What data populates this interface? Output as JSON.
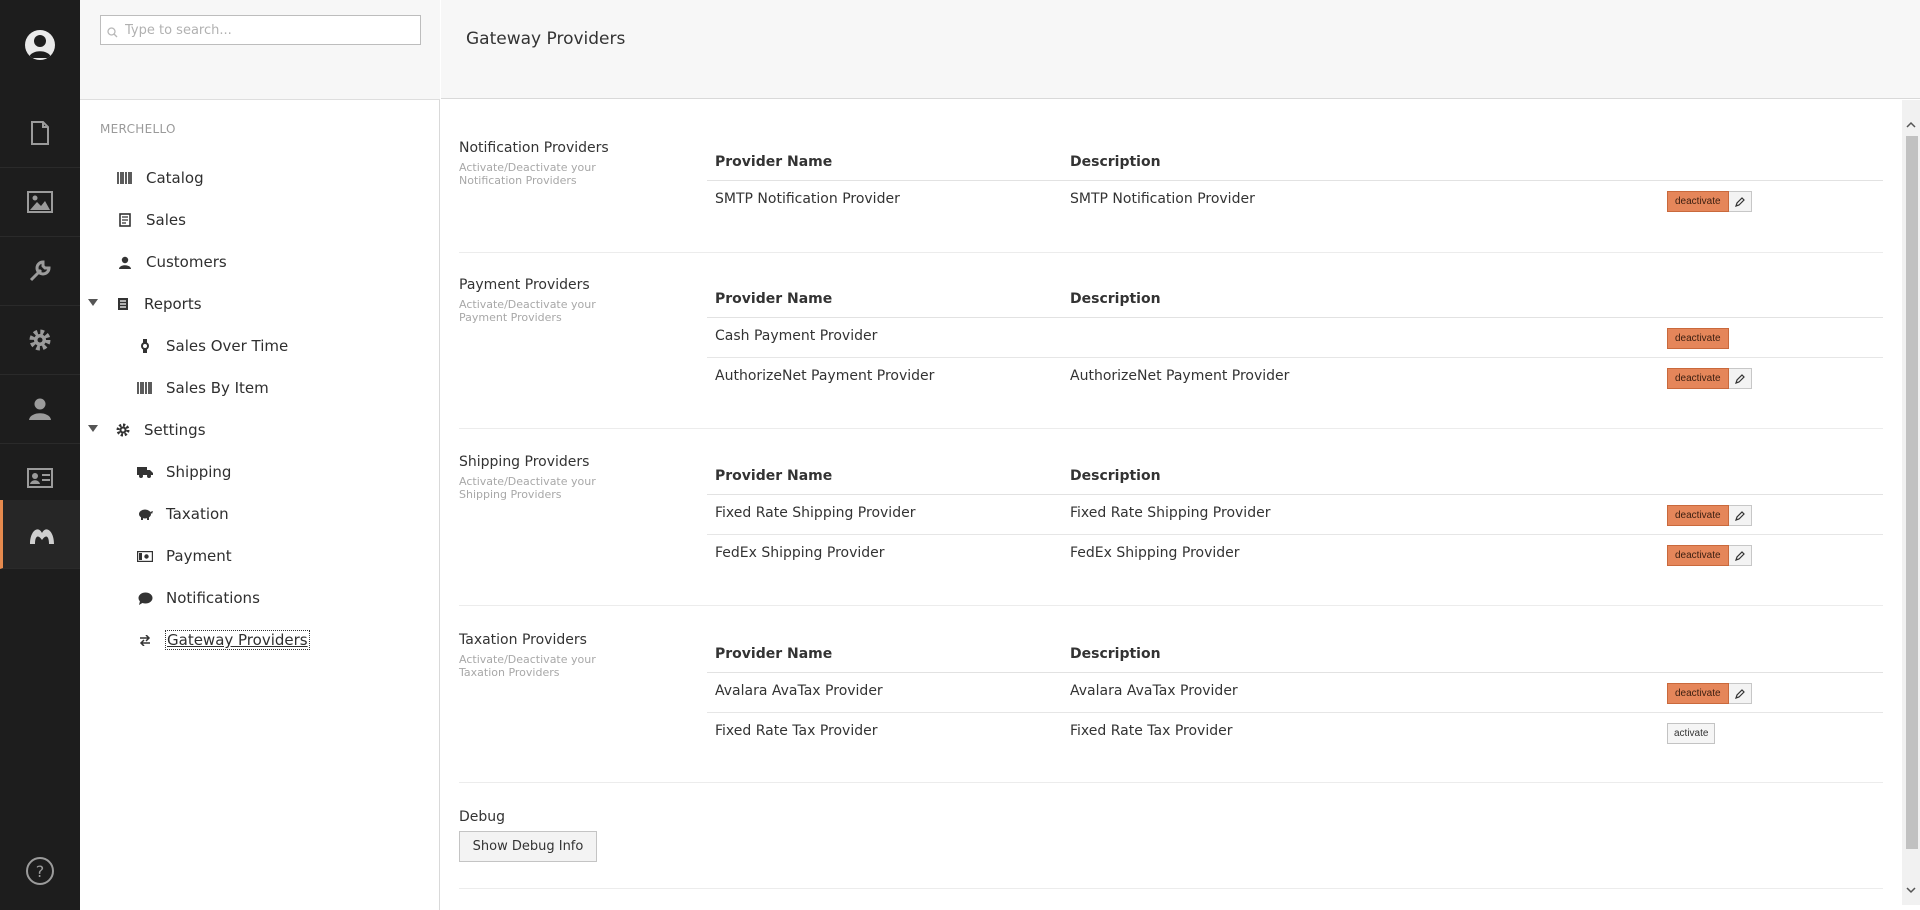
{
  "appbar": {
    "sections": [
      "content",
      "media",
      "developer",
      "settings",
      "users",
      "members",
      "merchello"
    ],
    "active": "merchello",
    "icons": {
      "avatar": "user-avatar-icon",
      "content": "document-icon",
      "media": "image-icon",
      "developer": "wrench-icon",
      "settings": "gear-icon",
      "users": "user-icon",
      "members": "id-card-icon",
      "merchello": "merchello-logo-icon",
      "help": "help-icon"
    }
  },
  "tree": {
    "search_placeholder": "Type to search...",
    "root_label": "MERCHELLO",
    "items": {
      "catalog": "Catalog",
      "sales": "Sales",
      "customers": "Customers",
      "reports": "Reports",
      "sales_over_time": "Sales Over Time",
      "sales_by_item": "Sales By Item",
      "settings": "Settings",
      "shipping": "Shipping",
      "taxation": "Taxation",
      "payment": "Payment",
      "notifications": "Notifications",
      "gateway_providers": "Gateway Providers"
    }
  },
  "header": {
    "title": "Gateway Providers"
  },
  "columns": {
    "name": "Provider Name",
    "description": "Description"
  },
  "sections": {
    "notification": {
      "title": "Notification Providers",
      "desc": "Activate/Deactivate your Notification Providers",
      "rows": [
        {
          "name": "SMTP Notification Provider",
          "description": "SMTP Notification Provider",
          "action": "deactivate"
        }
      ]
    },
    "payment": {
      "title": "Payment Providers",
      "desc": "Activate/Deactivate your Payment Providers",
      "rows": [
        {
          "name": "Cash Payment Provider",
          "description": "",
          "action": "deactivate"
        },
        {
          "name": "AuthorizeNet Payment Provider",
          "description": "AuthorizeNet Payment Provider",
          "action": "deactivate"
        }
      ]
    },
    "shipping": {
      "title": "Shipping Providers",
      "desc": "Activate/Deactivate your Shipping Providers",
      "rows": [
        {
          "name": "Fixed Rate Shipping Provider",
          "description": "Fixed Rate Shipping Provider",
          "action": "deactivate"
        },
        {
          "name": "FedEx Shipping Provider",
          "description": "FedEx Shipping Provider",
          "action": "deactivate"
        }
      ]
    },
    "taxation": {
      "title": "Taxation Providers",
      "desc": "Activate/Deactivate your Taxation Providers",
      "rows": [
        {
          "name": "Avalara AvaTax Provider",
          "description": "Avalara AvaTax Provider",
          "action": "deactivate"
        },
        {
          "name": "Fixed Rate Tax Provider",
          "description": "Fixed Rate Tax Provider",
          "action": "activate"
        }
      ]
    }
  },
  "debug": {
    "title": "Debug",
    "button": "Show Debug Info"
  },
  "colors": {
    "accent": "#e5865a",
    "appbar_bg": "#1d1d1d"
  }
}
